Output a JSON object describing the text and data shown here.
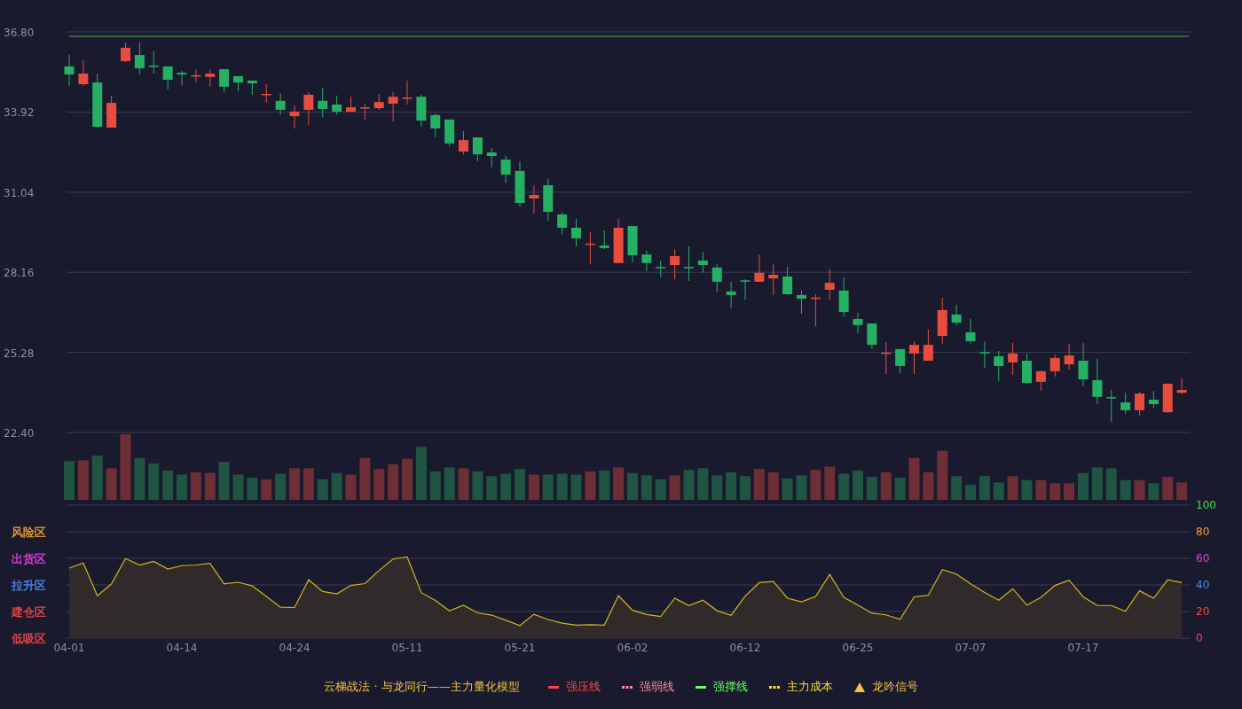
{
  "price_panel": {
    "chart_data": {
      "type": "candlestick",
      "grid": true,
      "ylim": [
        22.4,
        36.8
      ],
      "yticks": [
        {
          "value": 36.8,
          "label": "36.80"
        },
        {
          "value": 33.92,
          "label": "33.92"
        },
        {
          "value": 31.04,
          "label": "31.04"
        },
        {
          "value": 28.16,
          "label": "28.16"
        },
        {
          "value": 25.28,
          "label": "25.28"
        },
        {
          "value": 22.4,
          "label": "22.40"
        }
      ],
      "ohlc": [
        [
          35.56,
          35.97,
          34.86,
          35.27
        ],
        [
          34.92,
          35.78,
          34.86,
          35.3
        ],
        [
          34.98,
          35.3,
          33.36,
          33.39
        ],
        [
          33.36,
          34.51,
          33.36,
          34.25
        ],
        [
          35.75,
          36.42,
          35.72,
          36.23
        ],
        [
          35.97,
          36.42,
          35.27,
          35.49
        ],
        [
          35.59,
          36.1,
          35.3,
          35.57
        ],
        [
          35.56,
          35.56,
          34.73,
          35.08
        ],
        [
          35.33,
          35.4,
          34.89,
          35.27
        ],
        [
          35.22,
          35.46,
          34.98,
          35.24
        ],
        [
          35.18,
          35.46,
          34.83,
          35.3
        ],
        [
          35.46,
          35.46,
          34.63,
          34.83
        ],
        [
          35.21,
          35.21,
          34.67,
          34.98
        ],
        [
          35.05,
          35.05,
          34.54,
          34.95
        ],
        [
          34.55,
          34.92,
          34.25,
          34.57
        ],
        [
          34.32,
          34.6,
          33.81,
          34.0
        ],
        [
          33.77,
          34.16,
          33.33,
          33.93
        ],
        [
          34.0,
          34.63,
          33.46,
          34.54
        ],
        [
          34.32,
          34.79,
          33.74,
          34.03
        ],
        [
          34.19,
          34.51,
          33.81,
          33.93
        ],
        [
          33.93,
          34.47,
          33.93,
          34.09
        ],
        [
          34.08,
          34.22,
          33.65,
          34.09
        ],
        [
          34.06,
          34.57,
          34.0,
          34.28
        ],
        [
          34.22,
          34.63,
          33.58,
          34.47
        ],
        [
          34.42,
          35.05,
          34.19,
          34.44
        ],
        [
          34.47,
          34.54,
          33.39,
          33.61
        ],
        [
          33.81,
          33.87,
          33.01,
          33.33
        ],
        [
          33.65,
          33.65,
          32.69,
          32.79
        ],
        [
          32.5,
          33.23,
          32.4,
          32.91
        ],
        [
          33.01,
          33.01,
          32.15,
          32.4
        ],
        [
          32.47,
          32.63,
          31.93,
          32.34
        ],
        [
          32.21,
          32.34,
          31.38,
          31.67
        ],
        [
          31.8,
          32.15,
          30.52,
          30.65
        ],
        [
          30.81,
          31.29,
          30.27,
          30.94
        ],
        [
          31.29,
          31.51,
          30.01,
          30.33
        ],
        [
          30.24,
          30.33,
          29.51,
          29.76
        ],
        [
          29.76,
          30.08,
          29.09,
          29.38
        ],
        [
          29.18,
          29.6,
          28.45,
          29.19
        ],
        [
          29.12,
          29.66,
          28.99,
          29.03
        ],
        [
          28.49,
          30.08,
          28.49,
          29.76
        ],
        [
          29.82,
          29.82,
          28.52,
          28.77
        ],
        [
          28.8,
          28.93,
          28.2,
          28.49
        ],
        [
          28.35,
          28.58,
          27.98,
          28.33
        ],
        [
          28.42,
          28.99,
          27.91,
          28.74
        ],
        [
          28.35,
          29.09,
          27.85,
          28.33
        ],
        [
          28.58,
          28.9,
          28.14,
          28.42
        ],
        [
          28.33,
          28.45,
          27.43,
          27.82
        ],
        [
          27.47,
          27.82,
          26.86,
          27.34
        ],
        [
          27.87,
          27.91,
          27.18,
          27.85
        ],
        [
          27.82,
          28.8,
          27.82,
          28.14
        ],
        [
          27.94,
          28.45,
          27.34,
          28.07
        ],
        [
          28.01,
          28.36,
          27.34,
          27.37
        ],
        [
          27.34,
          27.5,
          26.67,
          27.21
        ],
        [
          27.23,
          27.37,
          26.22,
          27.25
        ],
        [
          27.53,
          28.26,
          27.18,
          27.78
        ],
        [
          27.5,
          27.98,
          26.57,
          26.73
        ],
        [
          26.48,
          26.7,
          25.97,
          26.26
        ],
        [
          26.32,
          26.32,
          25.4,
          25.55
        ],
        [
          25.25,
          25.65,
          24.5,
          25.27
        ],
        [
          25.4,
          25.4,
          24.54,
          24.79
        ],
        [
          25.24,
          25.68,
          24.5,
          25.55
        ],
        [
          24.98,
          26.1,
          24.98,
          25.55
        ],
        [
          25.87,
          27.24,
          25.59,
          26.8
        ],
        [
          26.64,
          26.99,
          26.26,
          26.35
        ],
        [
          26.0,
          26.48,
          25.59,
          25.68
        ],
        [
          25.29,
          25.68,
          24.73,
          25.27
        ],
        [
          25.14,
          25.33,
          24.25,
          24.79
        ],
        [
          24.92,
          25.62,
          24.47,
          25.24
        ],
        [
          24.98,
          25.24,
          24.15,
          24.18
        ],
        [
          24.22,
          24.63,
          23.9,
          24.6
        ],
        [
          24.6,
          25.2,
          24.41,
          25.08
        ],
        [
          24.85,
          25.59,
          24.66,
          25.17
        ],
        [
          24.98,
          25.62,
          24.06,
          24.31
        ],
        [
          24.28,
          25.05,
          23.42,
          23.68
        ],
        [
          23.67,
          23.93,
          22.78,
          23.64
        ],
        [
          23.48,
          23.83,
          23.07,
          23.2
        ],
        [
          23.2,
          23.87,
          23.01,
          23.8
        ],
        [
          23.58,
          23.9,
          23.29,
          23.42
        ],
        [
          23.13,
          24.18,
          23.1,
          24.15
        ],
        [
          23.83,
          24.34,
          23.77,
          23.93
        ]
      ],
      "ref_lines": [
        {
          "axis": "y",
          "value": 36.64
        }
      ]
    }
  },
  "indicator_panel": {
    "zone_labels": [
      {
        "label": "风险区",
        "color": "#f0a030"
      },
      {
        "label": "出货区",
        "color": "#e040e0"
      },
      {
        "label": "拉升区",
        "color": "#4a8cf0"
      },
      {
        "label": "建仓区",
        "color": "#f04848"
      },
      {
        "label": "低吸区",
        "color": "#f04848"
      }
    ],
    "axis_label_styles": [
      {
        "color": "#44dd55"
      },
      {
        "color": "#f0a030"
      },
      {
        "color": "#e040e0"
      },
      {
        "color": "#4a8cf0"
      },
      {
        "color": "#f04848"
      },
      {
        "color": "#f04848"
      }
    ],
    "chart_data": {
      "type": "area",
      "grid": true,
      "ylim": [
        0,
        100
      ],
      "yticks": [
        100,
        80,
        60,
        40,
        20,
        0
      ],
      "categories": [
        "04-01",
        null,
        null,
        null,
        null,
        null,
        null,
        null,
        "04-14",
        null,
        null,
        null,
        null,
        null,
        null,
        null,
        "04-24",
        null,
        null,
        null,
        null,
        null,
        null,
        null,
        "05-11",
        null,
        null,
        null,
        null,
        null,
        null,
        null,
        "05-21",
        null,
        null,
        null,
        null,
        null,
        null,
        null,
        "06-02",
        null,
        null,
        null,
        null,
        null,
        null,
        null,
        "06-12",
        null,
        null,
        null,
        null,
        null,
        null,
        null,
        "06-25",
        null,
        null,
        null,
        null,
        null,
        null,
        null,
        "07-07",
        null,
        null,
        null,
        null,
        null,
        null,
        null,
        "07-17",
        null,
        null,
        null,
        null,
        null,
        null,
        null
      ],
      "series": [
        {
          "color": "#d4b41c",
          "values": [
            52.7,
            56.5,
            31.8,
            40.8,
            59.8,
            55.0,
            57.7,
            52.0,
            54.5,
            55.0,
            56.3,
            40.8,
            42.0,
            39.3,
            31.3,
            23.2,
            23.0,
            43.8,
            35.1,
            33.3,
            39.6,
            41.0,
            50.9,
            59.5,
            61.0,
            34.2,
            28.3,
            20.5,
            24.7,
            19.0,
            17.3,
            13.4,
            9.5,
            17.9,
            14.0,
            11.3,
            9.8,
            10.1,
            9.8,
            32.0,
            20.9,
            17.8,
            16.3,
            30.0,
            24.5,
            28.5,
            20.6,
            17.2,
            31.6,
            41.7,
            42.6,
            30.0,
            27.3,
            31.3,
            47.9,
            30.7,
            24.8,
            18.7,
            17.5,
            14.1,
            31.0,
            32.2,
            51.5,
            48.2,
            40.8,
            34.4,
            28.5,
            37.1,
            24.8,
            30.7,
            39.6,
            43.6,
            31.0,
            24.5,
            24.5,
            20.2,
            35.6,
            30.0,
            43.9,
            41.7
          ]
        }
      ]
    }
  },
  "legend": {
    "title": "云梯战法 · 与龙同行——主力量化模型",
    "items": [
      {
        "kind": "line",
        "label": "强压线",
        "color": "#ff4444"
      },
      {
        "kind": "dashed",
        "label": "强弱线",
        "color": "#ff8899"
      },
      {
        "kind": "line",
        "label": "强撑线",
        "color": "#66ff66"
      },
      {
        "kind": "dashed",
        "label": "主力成本",
        "color": "#ffdd33"
      },
      {
        "kind": "triangle",
        "label": "龙吟信号",
        "color": "#f5c242"
      }
    ]
  }
}
